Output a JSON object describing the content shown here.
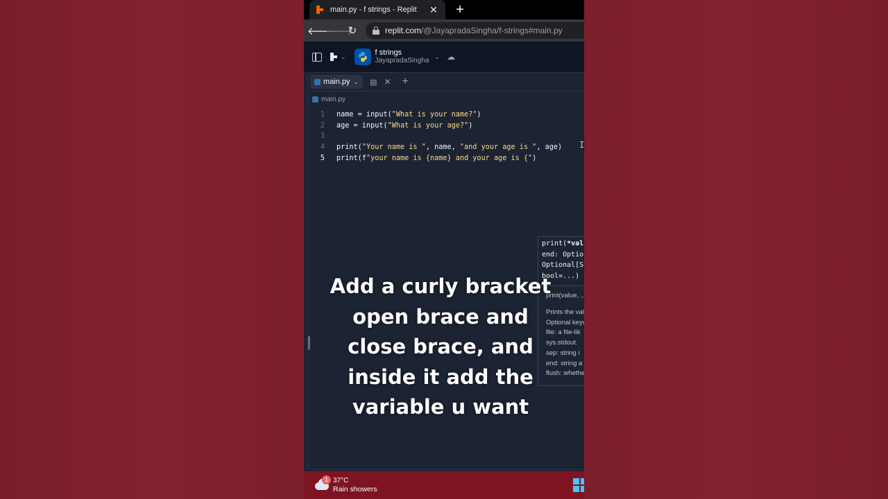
{
  "browser": {
    "tab_title": "main.py - f strings - Replit",
    "tab_close": "✕",
    "new_tab": "+",
    "url_host": "replit.com",
    "url_path": "/@JayapradaSingha/f-strings#main.py"
  },
  "replit_header": {
    "project_name": "f strings",
    "owner": "JayapradaSingha"
  },
  "editor": {
    "open_tab": "main.py",
    "breadcrumb": "main.py",
    "active_line": 5,
    "lines": [
      {
        "num": "1",
        "text": "name = input(\"What is your name?\")"
      },
      {
        "num": "2",
        "text": "age = input(\"What is your age?\")"
      },
      {
        "num": "3",
        "text": ""
      },
      {
        "num": "4",
        "text": "print(\"Your name is \", name, \"and your age is \", age)"
      },
      {
        "num": "5",
        "text": "print(f\"your name is {name} and your age is {\")"
      }
    ]
  },
  "popup": {
    "signature": [
      "print(*valu",
      "end: Optio",
      "Optional[Su",
      "bool=...) -"
    ],
    "signature_short": "print(value, ...",
    "doc": [
      "Prints the val",
      "Optional keyw",
      "file:  a file-lik",
      "sys.stdout.",
      "sep:   string i",
      "end:   string a",
      "flush: whethe"
    ]
  },
  "caption": {
    "lines": [
      "Add a curly bracket",
      "open brace and",
      "close brace, and",
      "inside it add the",
      "variable u want"
    ]
  },
  "taskbar": {
    "weather_badge": "1",
    "temperature": "37°C",
    "condition": "Rain showers"
  },
  "colors": {
    "background": "#7a1d2a",
    "editor_bg": "#1c2333",
    "string_yellow": "#fbdb87",
    "taskbar": "#7e1422"
  }
}
